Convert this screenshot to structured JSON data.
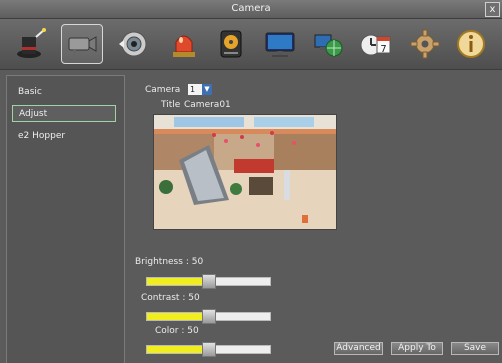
{
  "window": {
    "title": "Camera",
    "close_label": "x"
  },
  "toolbar": {
    "items": [
      {
        "icon": "magic-hat-icon"
      },
      {
        "icon": "camera-icon",
        "active": true
      },
      {
        "icon": "ptz-icon"
      },
      {
        "icon": "alarm-light-icon"
      },
      {
        "icon": "hard-disk-icon"
      },
      {
        "icon": "monitor-icon"
      },
      {
        "icon": "network-globe-icon"
      },
      {
        "icon": "schedule-icon"
      },
      {
        "icon": "gear-icon"
      },
      {
        "icon": "info-icon"
      }
    ],
    "schedule_badge": "7"
  },
  "sidebar": {
    "items": [
      {
        "label": "Basic"
      },
      {
        "label": "Adjust",
        "selected": true
      },
      {
        "label": "e2 Hopper"
      }
    ]
  },
  "camera": {
    "label": "Camera",
    "selected": "1",
    "title_label": "Title",
    "title_value": "Camera01"
  },
  "adjust": {
    "brightness": {
      "label": "Brightness",
      "value": 50
    },
    "contrast": {
      "label": "Contrast",
      "value": 50
    },
    "color": {
      "label": "Color",
      "value": 50
    }
  },
  "buttons": {
    "advanced": "Advanced",
    "apply": "Apply To",
    "save": "Save"
  },
  "colors": {
    "slider_fill": "#f1ee1f",
    "selection_border": "#9fd2a6"
  }
}
